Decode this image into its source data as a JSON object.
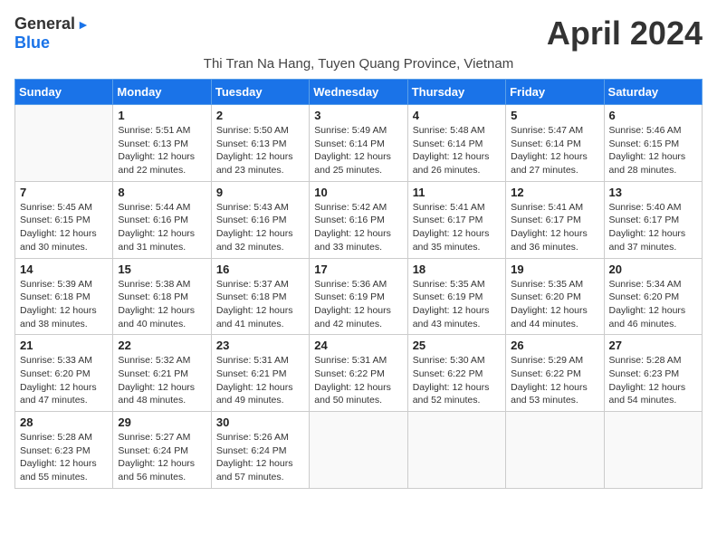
{
  "header": {
    "logo_general": "General",
    "logo_blue": "Blue",
    "month_title": "April 2024",
    "subtitle": "Thi Tran Na Hang, Tuyen Quang Province, Vietnam"
  },
  "weekdays": [
    "Sunday",
    "Monday",
    "Tuesday",
    "Wednesday",
    "Thursday",
    "Friday",
    "Saturday"
  ],
  "weeks": [
    [
      {
        "day": "",
        "info": ""
      },
      {
        "day": "1",
        "info": "Sunrise: 5:51 AM\nSunset: 6:13 PM\nDaylight: 12 hours\nand 22 minutes."
      },
      {
        "day": "2",
        "info": "Sunrise: 5:50 AM\nSunset: 6:13 PM\nDaylight: 12 hours\nand 23 minutes."
      },
      {
        "day": "3",
        "info": "Sunrise: 5:49 AM\nSunset: 6:14 PM\nDaylight: 12 hours\nand 25 minutes."
      },
      {
        "day": "4",
        "info": "Sunrise: 5:48 AM\nSunset: 6:14 PM\nDaylight: 12 hours\nand 26 minutes."
      },
      {
        "day": "5",
        "info": "Sunrise: 5:47 AM\nSunset: 6:14 PM\nDaylight: 12 hours\nand 27 minutes."
      },
      {
        "day": "6",
        "info": "Sunrise: 5:46 AM\nSunset: 6:15 PM\nDaylight: 12 hours\nand 28 minutes."
      }
    ],
    [
      {
        "day": "7",
        "info": "Sunrise: 5:45 AM\nSunset: 6:15 PM\nDaylight: 12 hours\nand 30 minutes."
      },
      {
        "day": "8",
        "info": "Sunrise: 5:44 AM\nSunset: 6:16 PM\nDaylight: 12 hours\nand 31 minutes."
      },
      {
        "day": "9",
        "info": "Sunrise: 5:43 AM\nSunset: 6:16 PM\nDaylight: 12 hours\nand 32 minutes."
      },
      {
        "day": "10",
        "info": "Sunrise: 5:42 AM\nSunset: 6:16 PM\nDaylight: 12 hours\nand 33 minutes."
      },
      {
        "day": "11",
        "info": "Sunrise: 5:41 AM\nSunset: 6:17 PM\nDaylight: 12 hours\nand 35 minutes."
      },
      {
        "day": "12",
        "info": "Sunrise: 5:41 AM\nSunset: 6:17 PM\nDaylight: 12 hours\nand 36 minutes."
      },
      {
        "day": "13",
        "info": "Sunrise: 5:40 AM\nSunset: 6:17 PM\nDaylight: 12 hours\nand 37 minutes."
      }
    ],
    [
      {
        "day": "14",
        "info": "Sunrise: 5:39 AM\nSunset: 6:18 PM\nDaylight: 12 hours\nand 38 minutes."
      },
      {
        "day": "15",
        "info": "Sunrise: 5:38 AM\nSunset: 6:18 PM\nDaylight: 12 hours\nand 40 minutes."
      },
      {
        "day": "16",
        "info": "Sunrise: 5:37 AM\nSunset: 6:18 PM\nDaylight: 12 hours\nand 41 minutes."
      },
      {
        "day": "17",
        "info": "Sunrise: 5:36 AM\nSunset: 6:19 PM\nDaylight: 12 hours\nand 42 minutes."
      },
      {
        "day": "18",
        "info": "Sunrise: 5:35 AM\nSunset: 6:19 PM\nDaylight: 12 hours\nand 43 minutes."
      },
      {
        "day": "19",
        "info": "Sunrise: 5:35 AM\nSunset: 6:20 PM\nDaylight: 12 hours\nand 44 minutes."
      },
      {
        "day": "20",
        "info": "Sunrise: 5:34 AM\nSunset: 6:20 PM\nDaylight: 12 hours\nand 46 minutes."
      }
    ],
    [
      {
        "day": "21",
        "info": "Sunrise: 5:33 AM\nSunset: 6:20 PM\nDaylight: 12 hours\nand 47 minutes."
      },
      {
        "day": "22",
        "info": "Sunrise: 5:32 AM\nSunset: 6:21 PM\nDaylight: 12 hours\nand 48 minutes."
      },
      {
        "day": "23",
        "info": "Sunrise: 5:31 AM\nSunset: 6:21 PM\nDaylight: 12 hours\nand 49 minutes."
      },
      {
        "day": "24",
        "info": "Sunrise: 5:31 AM\nSunset: 6:22 PM\nDaylight: 12 hours\nand 50 minutes."
      },
      {
        "day": "25",
        "info": "Sunrise: 5:30 AM\nSunset: 6:22 PM\nDaylight: 12 hours\nand 52 minutes."
      },
      {
        "day": "26",
        "info": "Sunrise: 5:29 AM\nSunset: 6:22 PM\nDaylight: 12 hours\nand 53 minutes."
      },
      {
        "day": "27",
        "info": "Sunrise: 5:28 AM\nSunset: 6:23 PM\nDaylight: 12 hours\nand 54 minutes."
      }
    ],
    [
      {
        "day": "28",
        "info": "Sunrise: 5:28 AM\nSunset: 6:23 PM\nDaylight: 12 hours\nand 55 minutes."
      },
      {
        "day": "29",
        "info": "Sunrise: 5:27 AM\nSunset: 6:24 PM\nDaylight: 12 hours\nand 56 minutes."
      },
      {
        "day": "30",
        "info": "Sunrise: 5:26 AM\nSunset: 6:24 PM\nDaylight: 12 hours\nand 57 minutes."
      },
      {
        "day": "",
        "info": ""
      },
      {
        "day": "",
        "info": ""
      },
      {
        "day": "",
        "info": ""
      },
      {
        "day": "",
        "info": ""
      }
    ]
  ]
}
